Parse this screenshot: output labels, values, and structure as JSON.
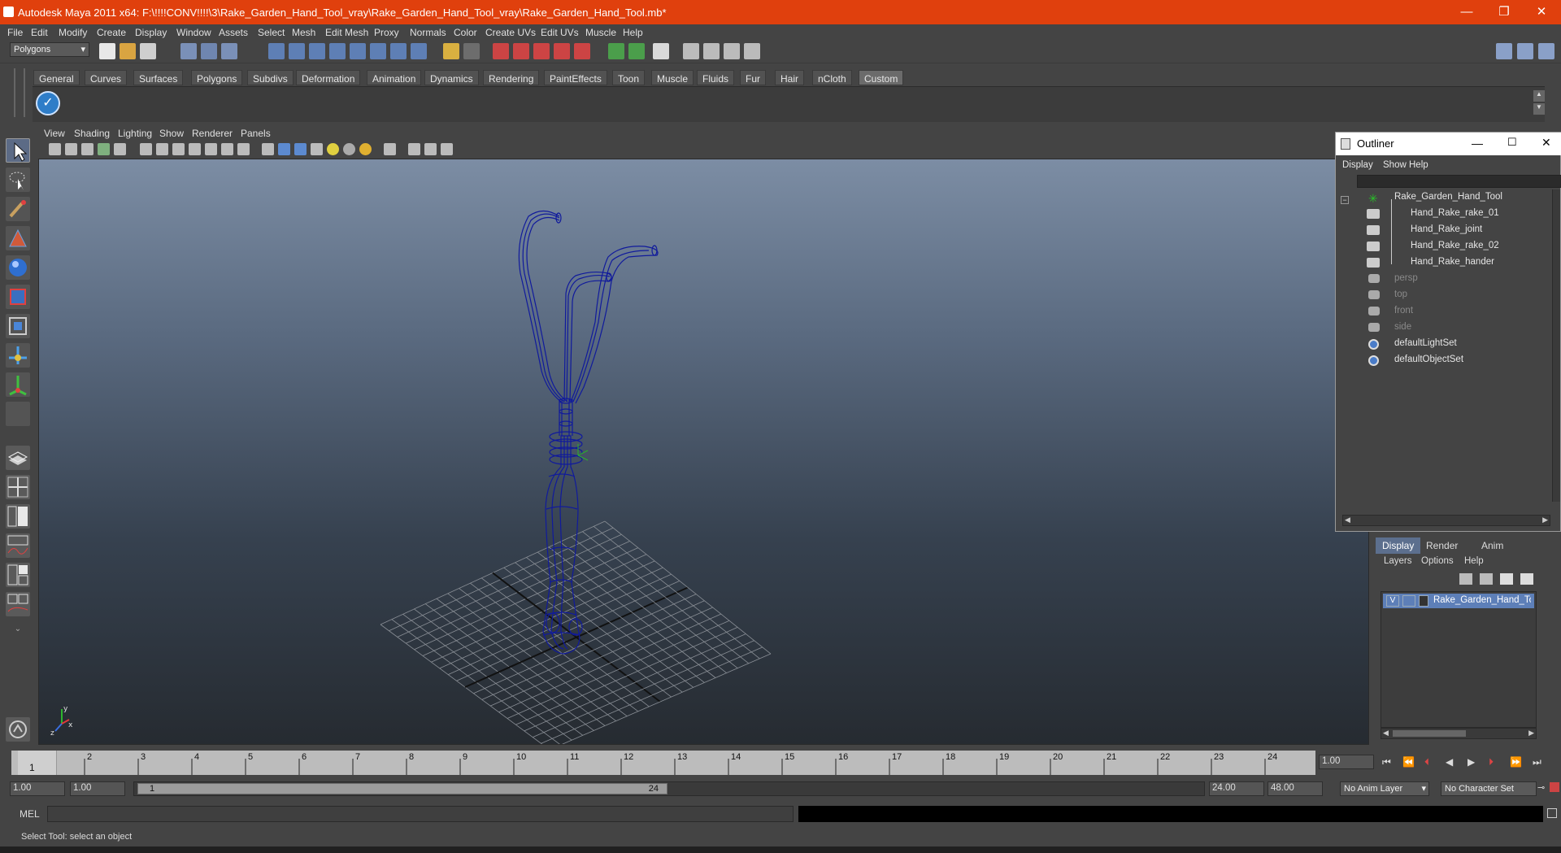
{
  "window": {
    "title": "Autodesk Maya 2011 x64: F:\\!!!!CONV!!!!\\3\\Rake_Garden_Hand_Tool_vray\\Rake_Garden_Hand_Tool_vray\\Rake_Garden_Hand_Tool.mb*",
    "minimize": "—",
    "restore": "❐",
    "close": "✕"
  },
  "menubar": [
    "File",
    "Edit",
    "Modify",
    "Create",
    "Display",
    "Window",
    "Assets",
    "Select",
    "Mesh",
    "Edit Mesh",
    "Proxy",
    "Normals",
    "Color",
    "Create UVs",
    "Edit UVs",
    "Muscle",
    "Help"
  ],
  "statusline": {
    "mode": "Polygons"
  },
  "shelf": {
    "tabs": [
      "General",
      "Curves",
      "Surfaces",
      "Polygons",
      "Subdivs",
      "Deformation",
      "Animation",
      "Dynamics",
      "Rendering",
      "PaintEffects",
      "Toon",
      "Muscle",
      "Fluids",
      "Fur",
      "Hair",
      "nCloth",
      "Custom"
    ],
    "active": "Custom"
  },
  "panel": {
    "menus": [
      "View",
      "Shading",
      "Lighting",
      "Show",
      "Renderer",
      "Panels"
    ]
  },
  "outliner": {
    "title": "Outliner",
    "menus": [
      "Display",
      "Show",
      "Help"
    ],
    "items": [
      {
        "label": "Rake_Garden_Hand_Tool",
        "indent": 0,
        "dim": false
      },
      {
        "label": "Hand_Rake_rake_01",
        "indent": 1,
        "dim": false
      },
      {
        "label": "Hand_Rake_joint",
        "indent": 1,
        "dim": false
      },
      {
        "label": "Hand_Rake_rake_02",
        "indent": 1,
        "dim": false
      },
      {
        "label": "Hand_Rake_hander",
        "indent": 1,
        "dim": false
      },
      {
        "label": "persp",
        "indent": 0,
        "dim": true
      },
      {
        "label": "top",
        "indent": 0,
        "dim": true
      },
      {
        "label": "front",
        "indent": 0,
        "dim": true
      },
      {
        "label": "side",
        "indent": 0,
        "dim": true
      },
      {
        "label": "defaultLightSet",
        "indent": 0,
        "dim": false
      },
      {
        "label": "defaultObjectSet",
        "indent": 0,
        "dim": false
      }
    ]
  },
  "layereditor": {
    "tabs": [
      "Display",
      "Render",
      "Anim"
    ],
    "menus": [
      "Layers",
      "Options",
      "Help"
    ],
    "layer": {
      "visible": "V",
      "name": "Rake_Garden_Hand_Tool"
    }
  },
  "timeslider": {
    "ticks": [
      "1",
      "2",
      "3",
      "4",
      "5",
      "6",
      "7",
      "8",
      "9",
      "10",
      "11",
      "12",
      "13",
      "14",
      "15",
      "16",
      "17",
      "18",
      "19",
      "20",
      "21",
      "22",
      "23",
      "24"
    ],
    "current_frame": "1",
    "current_time_field": "1.00"
  },
  "rangeslider": {
    "start_time": "1.00",
    "playback_start": "1.00",
    "range_start_label": "1",
    "range_end_label": "24",
    "playback_end": "24.00",
    "end_time": "48.00",
    "anim_layer": "No Anim Layer",
    "character_set": "No Character Set"
  },
  "commandline": {
    "label": "MEL"
  },
  "helpline": {
    "text": "Select Tool: select an object"
  },
  "colors": {
    "titlebar": "#e0400d",
    "wireframe": "#101a9c",
    "selected_layer": "#5d7fb8"
  }
}
